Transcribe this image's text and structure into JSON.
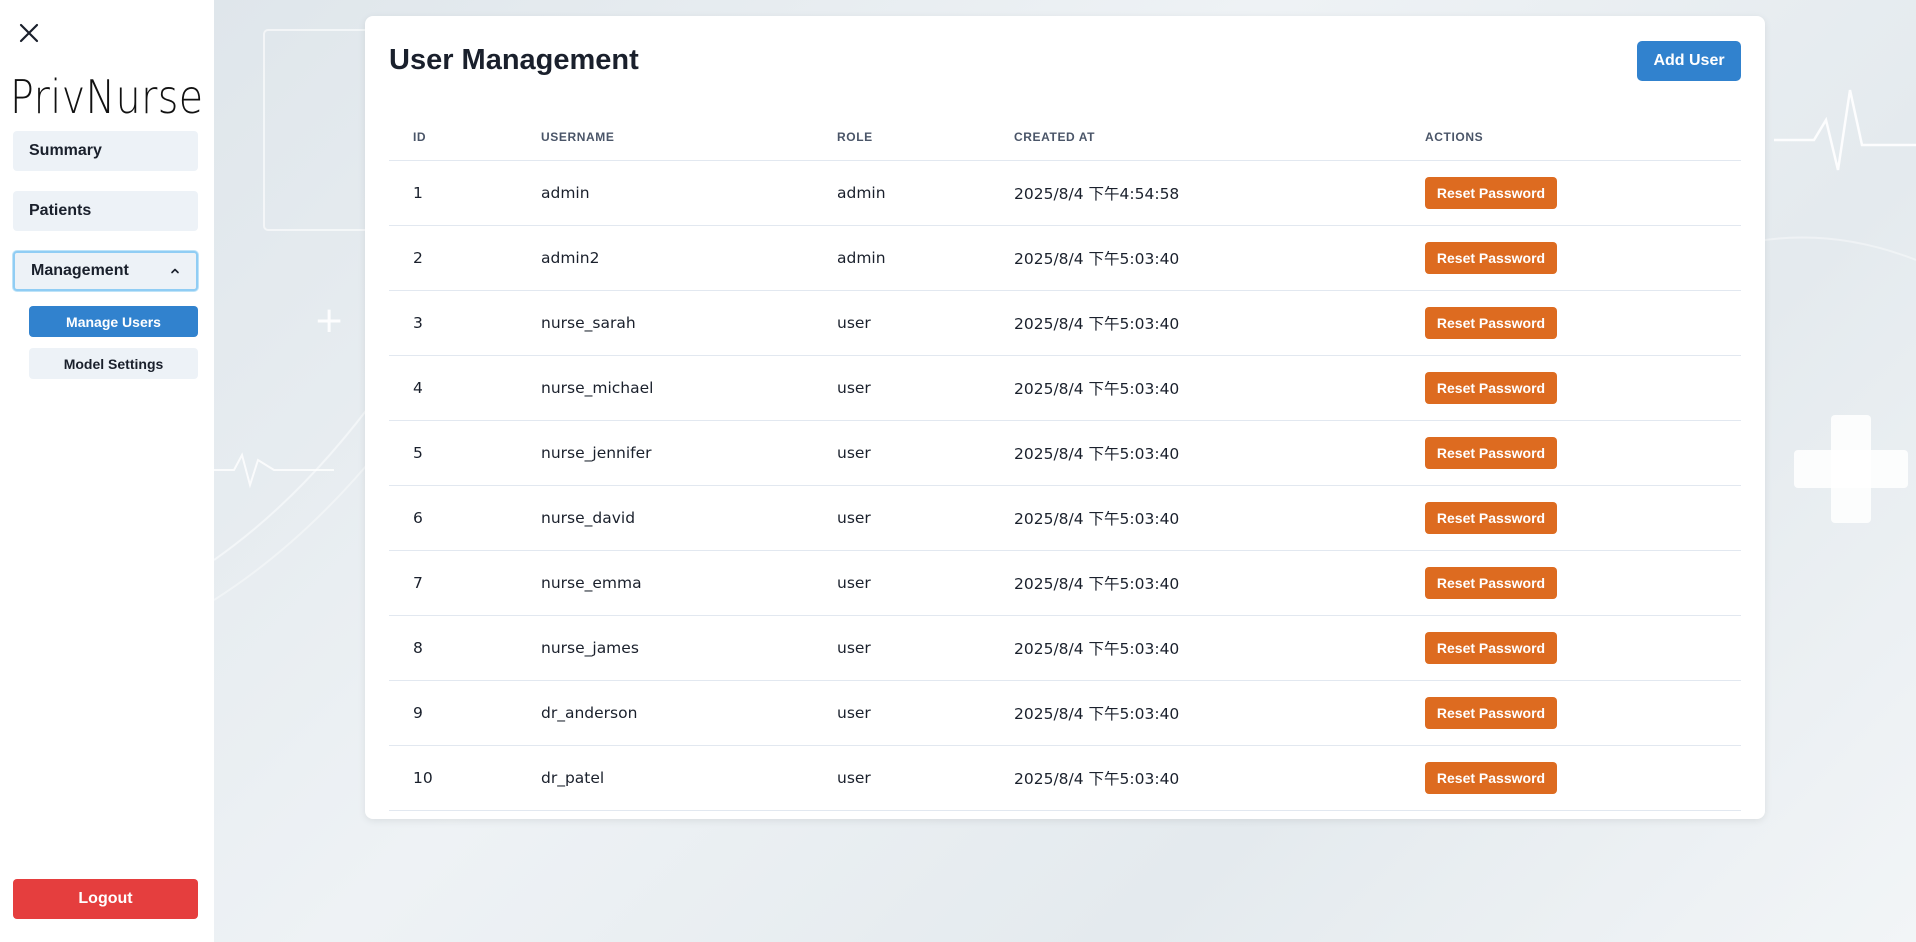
{
  "app": {
    "brand": "PrivNurse"
  },
  "sidebar": {
    "items": [
      {
        "label": "Summary"
      },
      {
        "label": "Patients"
      },
      {
        "label": "Management"
      }
    ],
    "sub_items": [
      {
        "label": "Manage Users"
      },
      {
        "label": "Model Settings"
      }
    ],
    "logout_label": "Logout"
  },
  "main": {
    "title": "User Management",
    "add_user_label": "Add User",
    "table": {
      "headers": [
        "ID",
        "USERNAME",
        "ROLE",
        "CREATED AT",
        "ACTIONS"
      ],
      "action_label": "Reset Password",
      "rows": [
        {
          "id": "1",
          "username": "admin",
          "role": "admin",
          "created_at": "2025/8/4 下午4:54:58"
        },
        {
          "id": "2",
          "username": "admin2",
          "role": "admin",
          "created_at": "2025/8/4 下午5:03:40"
        },
        {
          "id": "3",
          "username": "nurse_sarah",
          "role": "user",
          "created_at": "2025/8/4 下午5:03:40"
        },
        {
          "id": "4",
          "username": "nurse_michael",
          "role": "user",
          "created_at": "2025/8/4 下午5:03:40"
        },
        {
          "id": "5",
          "username": "nurse_jennifer",
          "role": "user",
          "created_at": "2025/8/4 下午5:03:40"
        },
        {
          "id": "6",
          "username": "nurse_david",
          "role": "user",
          "created_at": "2025/8/4 下午5:03:40"
        },
        {
          "id": "7",
          "username": "nurse_emma",
          "role": "user",
          "created_at": "2025/8/4 下午5:03:40"
        },
        {
          "id": "8",
          "username": "nurse_james",
          "role": "user",
          "created_at": "2025/8/4 下午5:03:40"
        },
        {
          "id": "9",
          "username": "dr_anderson",
          "role": "user",
          "created_at": "2025/8/4 下午5:03:40"
        },
        {
          "id": "10",
          "username": "dr_patel",
          "role": "user",
          "created_at": "2025/8/4 下午5:03:40"
        }
      ]
    }
  },
  "colors": {
    "primary": "#3182ce",
    "danger": "#e53e3e",
    "warning": "#dd6b20"
  },
  "icons": {
    "close": "close-icon",
    "chevron": "chevron-up-icon"
  }
}
